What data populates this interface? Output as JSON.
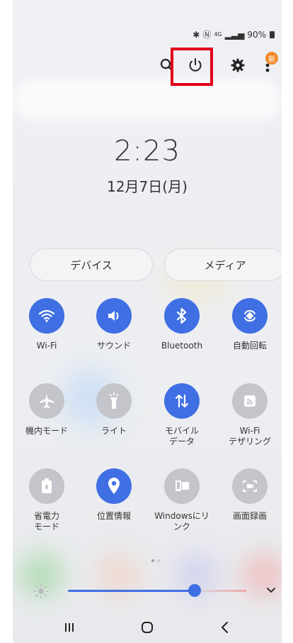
{
  "status_bar": {
    "battery": "90%",
    "net_tag": "4G"
  },
  "top_bar": {
    "new_badge": "新"
  },
  "clock": {
    "time": "2:23",
    "date": "12月7日(月)"
  },
  "panels": {
    "devices_label": "デバイス",
    "media_label": "メディア"
  },
  "tiles": [
    {
      "label": "Wi-Fi",
      "state": "on",
      "icon": "wifi-icon"
    },
    {
      "label": "サウンド",
      "state": "on",
      "icon": "sound-icon"
    },
    {
      "label": "Bluetooth",
      "state": "on",
      "icon": "bluetooth-icon"
    },
    {
      "label": "自動回転",
      "state": "on",
      "icon": "auto-rotate-icon"
    },
    {
      "label": "機内モード",
      "state": "off",
      "icon": "airplane-icon"
    },
    {
      "label": "ライト",
      "state": "off",
      "icon": "flashlight-icon"
    },
    {
      "label": "モバイル データ",
      "state": "on",
      "icon": "mobile-data-icon"
    },
    {
      "label": "Wi-Fi テザリング",
      "state": "off",
      "icon": "hotspot-icon"
    },
    {
      "label": "省電力 モード",
      "state": "off",
      "icon": "power-saving-icon"
    },
    {
      "label": "位置情報",
      "state": "on",
      "icon": "location-icon"
    },
    {
      "label": "Windowsにリ ンク",
      "state": "off",
      "icon": "link-to-windows-icon"
    },
    {
      "label": "画面録画",
      "state": "off",
      "icon": "screen-record-icon"
    }
  ],
  "brightness": {
    "level": 0.71
  },
  "colors": {
    "accent": "#3f6fe3",
    "highlight": "#e3001b",
    "inactive": "#c3c5ca"
  }
}
